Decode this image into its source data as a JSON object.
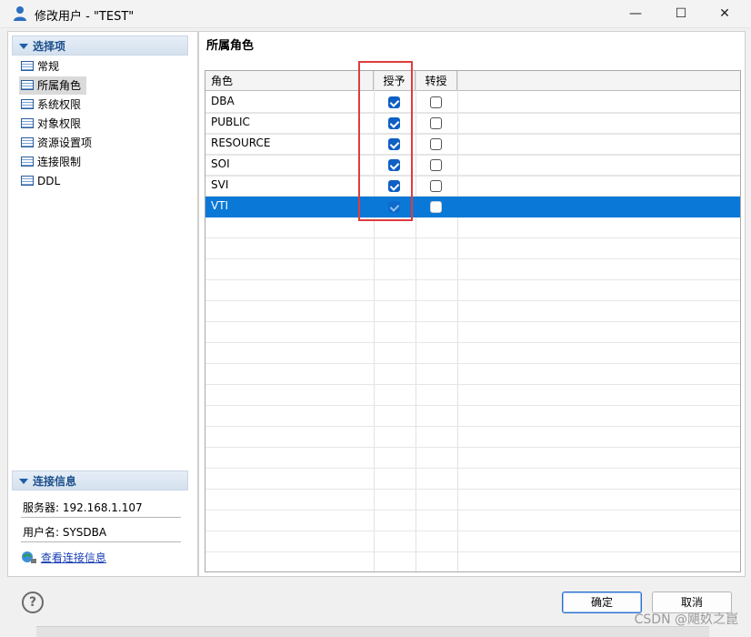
{
  "window": {
    "title": "修改用户 - \"TEST\"",
    "minimize": "—",
    "maximize": "☐",
    "close": "✕"
  },
  "left": {
    "options_header": "选择项",
    "nav": [
      {
        "label": "常规"
      },
      {
        "label": "所属角色",
        "selected": true
      },
      {
        "label": "系统权限"
      },
      {
        "label": "对象权限"
      },
      {
        "label": "资源设置项"
      },
      {
        "label": "连接限制"
      },
      {
        "label": "DDL"
      }
    ],
    "conn_header": "连接信息",
    "server": "服务器: 192.168.1.107",
    "username": "用户名: SYSDBA",
    "view_conn_link": "查看连接信息"
  },
  "main": {
    "title": "所属角色",
    "columns": [
      "角色",
      "授予",
      "转授"
    ],
    "rows": [
      {
        "role": "DBA",
        "grant": true,
        "regrant": false
      },
      {
        "role": "PUBLIC",
        "grant": true,
        "regrant": false
      },
      {
        "role": "RESOURCE",
        "grant": true,
        "regrant": false
      },
      {
        "role": "SOI",
        "grant": true,
        "regrant": false
      },
      {
        "role": "SVI",
        "grant": true,
        "regrant": false
      },
      {
        "role": "VTI",
        "grant": true,
        "regrant": false,
        "selected": true
      }
    ]
  },
  "footer": {
    "help": "?",
    "ok": "确定",
    "cancel": "取消",
    "watermark": "CSDN @飓奺之崑"
  },
  "colors": {
    "selection": "#0a78d6",
    "checkbox": "#0f5fc4",
    "annotation": "#e03c3c"
  }
}
